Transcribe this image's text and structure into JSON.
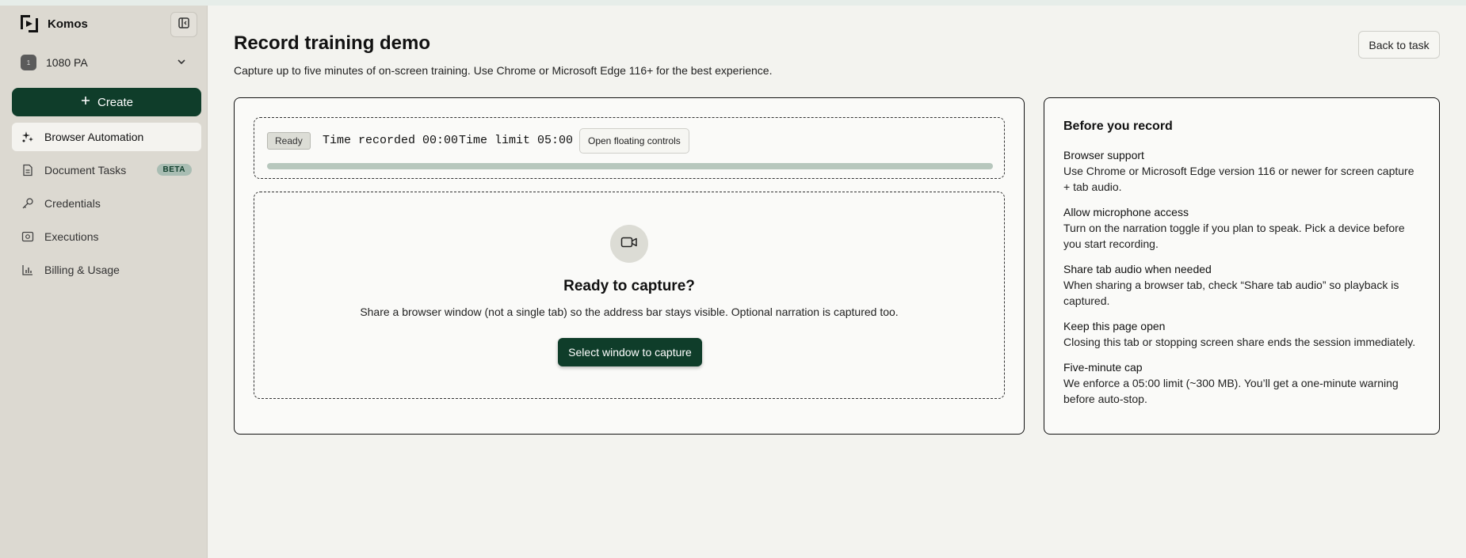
{
  "sidebar": {
    "brand": "Komos",
    "org": {
      "badge": "1",
      "name": "1080 PA"
    },
    "create_label": "Create",
    "items": [
      {
        "label": "Browser Automation",
        "icon": "sparkle-icon",
        "active": true
      },
      {
        "label": "Document Tasks",
        "icon": "document-icon",
        "badge": "BETA"
      },
      {
        "label": "Credentials",
        "icon": "key-icon"
      },
      {
        "label": "Executions",
        "icon": "executions-icon"
      },
      {
        "label": "Billing & Usage",
        "icon": "bar-chart-icon"
      }
    ]
  },
  "header": {
    "title": "Record training demo",
    "subtitle": "Capture up to five minutes of on-screen training. Use Chrome or Microsoft Edge 116+ for the best experience.",
    "back_label": "Back to task"
  },
  "recorder": {
    "status": "Ready",
    "time_recorded": "Time recorded 00:00",
    "time_limit": "Time limit 05:00",
    "floating_label": "Open floating controls",
    "progress": 0
  },
  "capture": {
    "title": "Ready to capture?",
    "description": "Share a browser window (not a single tab) so the address bar stays visible. Optional narration is captured too.",
    "button_label": "Select window to capture"
  },
  "tips": {
    "title": "Before you record",
    "items": [
      {
        "title": "Browser support",
        "body": "Use Chrome or Microsoft Edge version 116 or newer for screen capture + tab audio."
      },
      {
        "title": "Allow microphone access",
        "body": "Turn on the narration toggle if you plan to speak. Pick a device before you start recording."
      },
      {
        "title": "Share tab audio when needed",
        "body": "When sharing a browser tab, check “Share tab audio” so playback is captured."
      },
      {
        "title": "Keep this page open",
        "body": "Closing this tab or stopping screen share ends the session immediately."
      },
      {
        "title": "Five-minute cap",
        "body": "We enforce a 05:00 limit (~300 MB). You’ll get a one-minute warning before auto-stop."
      }
    ]
  },
  "colors": {
    "accent": "#0f3d2a",
    "sidebar": "#dcd9d1",
    "background": "#f3f3ef"
  }
}
